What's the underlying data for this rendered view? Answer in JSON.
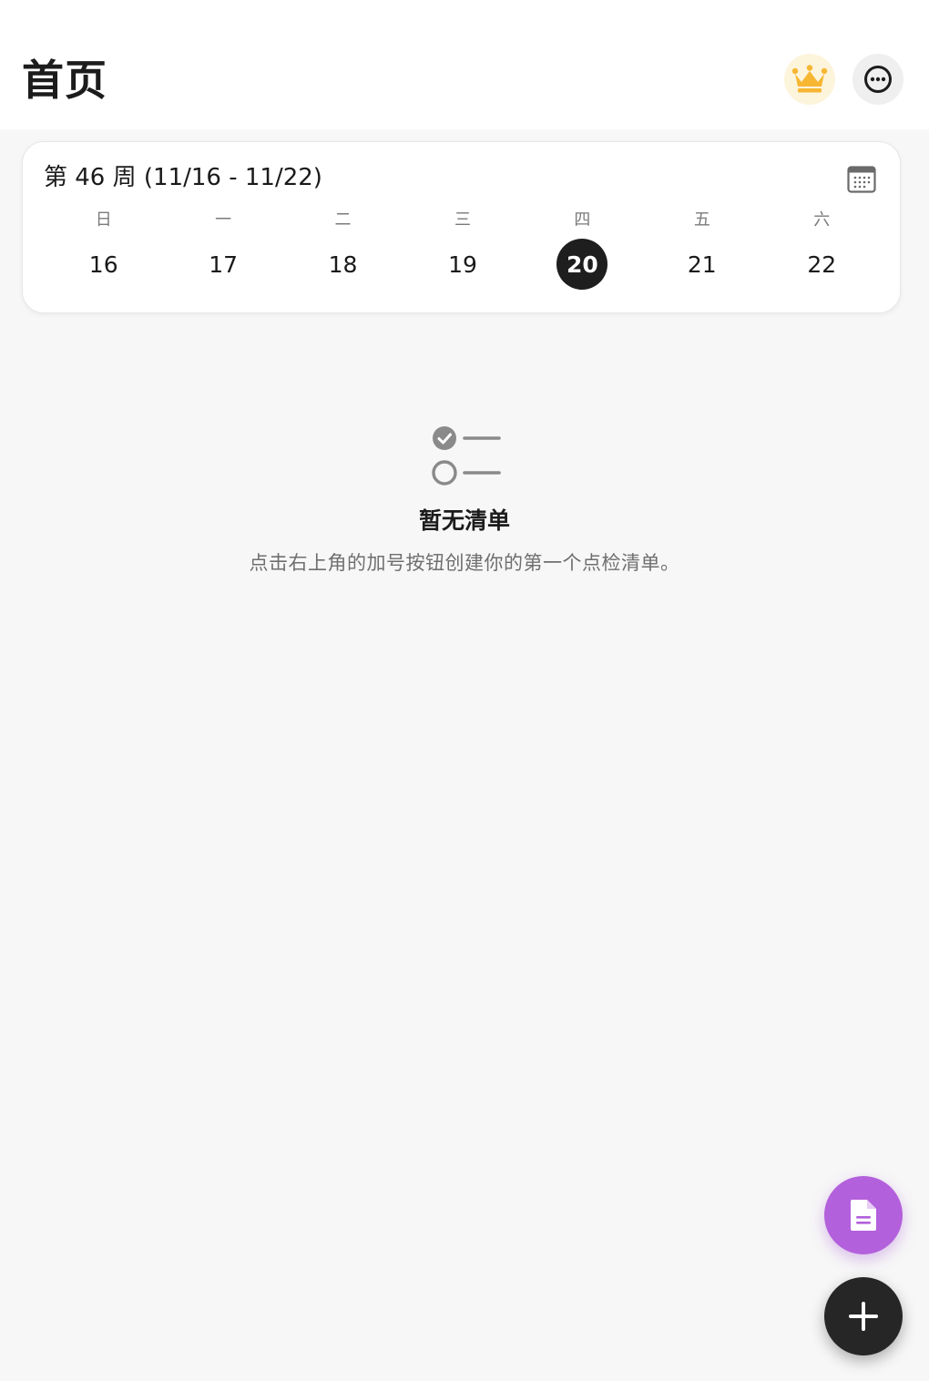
{
  "header": {
    "title": "首页"
  },
  "week": {
    "title": "第 46 周 (11/16 - 11/22)",
    "days": [
      {
        "weekday": "日",
        "date": "16"
      },
      {
        "weekday": "一",
        "date": "17"
      },
      {
        "weekday": "二",
        "date": "18"
      },
      {
        "weekday": "三",
        "date": "19"
      },
      {
        "weekday": "四",
        "date": "20",
        "selected": true
      },
      {
        "weekday": "五",
        "date": "21"
      },
      {
        "weekday": "六",
        "date": "22"
      }
    ]
  },
  "empty_state": {
    "title": "暂无清单",
    "description": "点击右上角的加号按钮创建你的第一个点检清单。"
  },
  "icons": {
    "premium": "crown-icon",
    "more": "more-horizontal-icon",
    "calendar": "calendar-icon",
    "empty": "checklist-icon",
    "document_fab": "document-icon",
    "add_fab": "plus-icon"
  },
  "colors": {
    "crown": "#f7b733",
    "premium_bg": "#fdf4dc",
    "selected_day_bg": "#1e1e1e",
    "document_fab": "#b360dc",
    "add_fab": "#262626",
    "page_bg": "#f7f7f7"
  }
}
